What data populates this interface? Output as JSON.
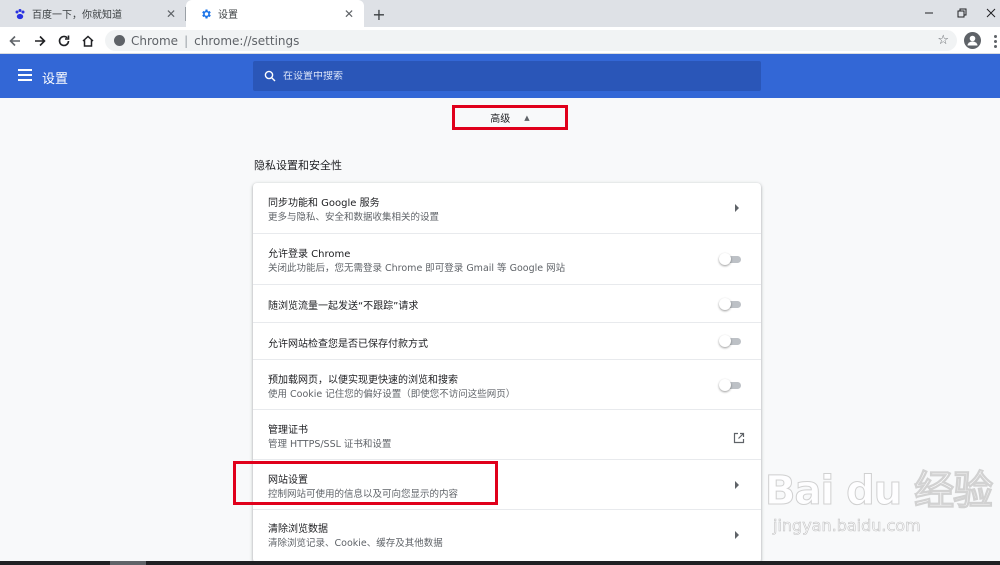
{
  "tabs": [
    {
      "title": "百度一下，你就知道",
      "icon": "baidu-paw-icon",
      "active": false
    },
    {
      "title": "设置",
      "icon": "gear-icon",
      "active": true
    }
  ],
  "address": {
    "origin": "Chrome",
    "url": "chrome://settings"
  },
  "header": {
    "title": "设置",
    "search_placeholder": "在设置中搜索"
  },
  "advanced": {
    "label": "高级"
  },
  "section": {
    "title": "隐私设置和安全性"
  },
  "rows": [
    {
      "label": "同步功能和 Google 服务",
      "sub": "更多与隐私、安全和数据收集相关的设置",
      "control": "chevron"
    },
    {
      "label": "允许登录 Chrome",
      "sub": "关闭此功能后，您无需登录 Chrome 即可登录 Gmail 等 Google 网站",
      "control": "toggle",
      "on": false
    },
    {
      "label": "随浏览流量一起发送“不跟踪”请求",
      "control": "toggle",
      "on": false
    },
    {
      "label": "允许网站检查您是否已保存付款方式",
      "control": "toggle",
      "on": false
    },
    {
      "label": "预加载网页，以便实现更快速的浏览和搜索",
      "sub": "使用 Cookie 记住您的偏好设置（即使您不访问这些网页）",
      "control": "toggle",
      "on": false
    },
    {
      "label": "管理证书",
      "sub": "管理 HTTPS/SSL 证书和设置",
      "control": "external-link"
    },
    {
      "label": "网站设置",
      "sub": "控制网站可使用的信息以及可向您显示的内容",
      "control": "chevron"
    },
    {
      "label": "清除浏览数据",
      "sub": "清除浏览记录、Cookie、缓存及其他数据",
      "control": "chevron"
    }
  ],
  "watermark": {
    "logo": "Bai du 经验",
    "url": "jingyan.baidu.com"
  },
  "colors": {
    "header": "#3367d6",
    "search": "#2a56b8",
    "highlight": "#e0001b"
  }
}
